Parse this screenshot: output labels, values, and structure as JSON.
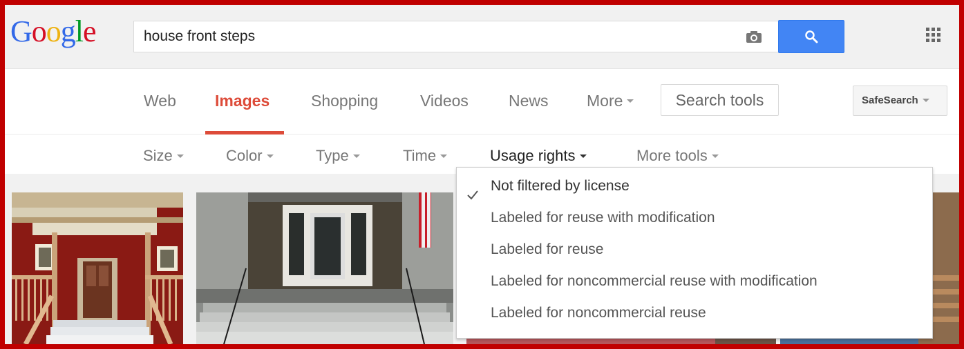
{
  "logo": {
    "text": "Google"
  },
  "search": {
    "value": "house front steps"
  },
  "icons": {
    "camera": "camera-icon",
    "search": "search-icon",
    "apps": "apps-grid-icon",
    "check": "check-icon"
  },
  "nav": {
    "tabs": [
      {
        "label": "Web",
        "active": false
      },
      {
        "label": "Images",
        "active": true
      },
      {
        "label": "Shopping",
        "active": false
      },
      {
        "label": "Videos",
        "active": false
      },
      {
        "label": "News",
        "active": false
      },
      {
        "label": "More",
        "active": false
      }
    ],
    "search_tools": "Search tools",
    "safesearch": "SafeSearch"
  },
  "tools": [
    {
      "label": "Size",
      "active": false
    },
    {
      "label": "Color",
      "active": false
    },
    {
      "label": "Type",
      "active": false
    },
    {
      "label": "Time",
      "active": false
    },
    {
      "label": "Usage rights",
      "active": true
    },
    {
      "label": "More tools",
      "active": false
    }
  ],
  "usage_rights_menu": {
    "items": [
      {
        "label": "Not filtered by license",
        "selected": true
      },
      {
        "label": "Labeled for reuse with modification",
        "selected": false
      },
      {
        "label": "Labeled for reuse",
        "selected": false
      },
      {
        "label": "Labeled for noncommercial reuse with modification",
        "selected": false
      },
      {
        "label": "Labeled for noncommercial reuse",
        "selected": false
      }
    ]
  },
  "colors": {
    "frame": "#c00000",
    "accent_red": "#dd4b39",
    "search_blue": "#4285f4"
  }
}
